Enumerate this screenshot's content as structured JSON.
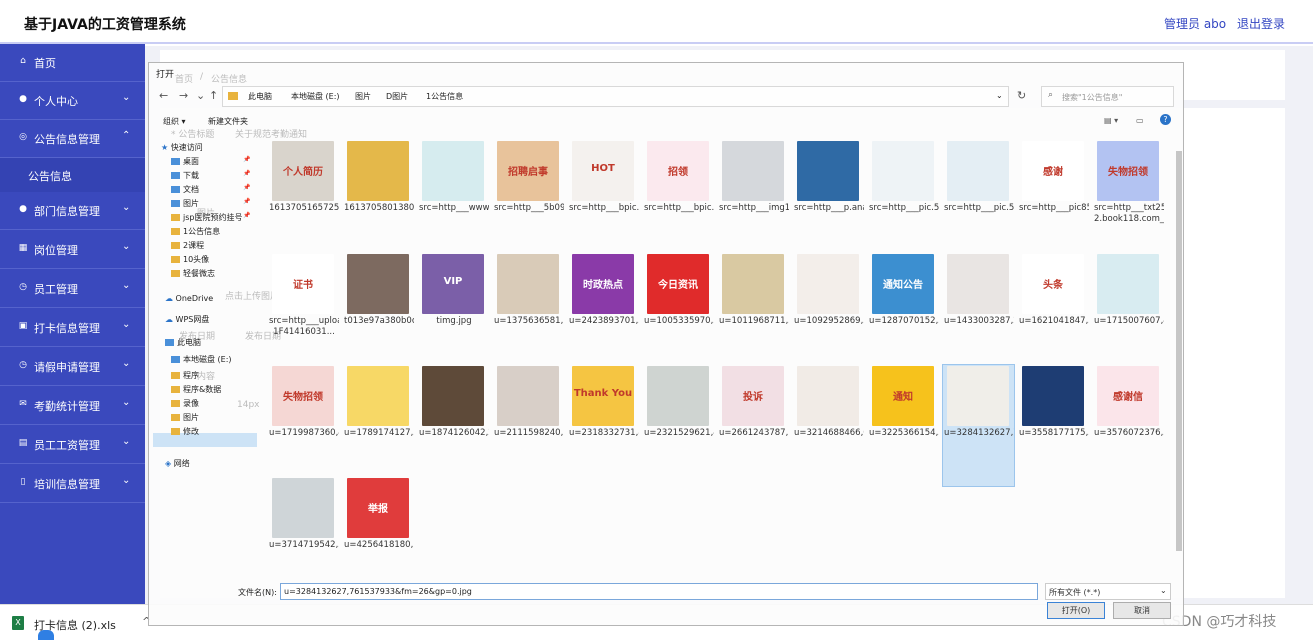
{
  "app": {
    "title": "基于JAVA的工资管理系统",
    "user": "管理员 abo",
    "logout": "退出登录"
  },
  "sidebar": {
    "items": [
      {
        "label": "首页",
        "icon": "home-icon"
      },
      {
        "label": "个人中心",
        "icon": "user-icon"
      },
      {
        "label": "公告信息管理",
        "icon": "info-icon"
      },
      {
        "label": "部门信息管理",
        "icon": "user-icon"
      },
      {
        "label": "岗位管理",
        "icon": "grid-icon"
      },
      {
        "label": "员工管理",
        "icon": "clock-icon"
      },
      {
        "label": "打卡信息管理",
        "icon": "clock-in-icon"
      },
      {
        "label": "请假申请管理",
        "icon": "clock-icon"
      },
      {
        "label": "考勤统计管理",
        "icon": "stats-icon"
      },
      {
        "label": "员工工资管理",
        "icon": "salary-icon"
      },
      {
        "label": "培训信息管理",
        "icon": "training-icon"
      }
    ],
    "sub_item": "公告信息"
  },
  "ghost": {
    "breadcrumb_home": "首页",
    "breadcrumb_sep": "/",
    "breadcrumb_current": "公告信息",
    "title_label": "* 公告标题",
    "title_value": "关于规范考勤通知",
    "image_label": "图片",
    "upload_hint": "点击上传图片",
    "publish_date": "发布日期",
    "publish_date_value": "发布日期",
    "content_label": "内容",
    "editor_font_size": "14px",
    "editor_body": "文本"
  },
  "dialog": {
    "title": "打开",
    "path": [
      "此电脑",
      "本地磁盘 (E:)",
      "图片",
      "D图片",
      "1公告信息"
    ],
    "search_placeholder": "搜索\"1公告信息\"",
    "organize": "组织 ▾",
    "new_folder": "新建文件夹",
    "tree": [
      {
        "label": "快速访问",
        "type": "star"
      },
      {
        "label": "桌面",
        "type": "blue",
        "pin": true
      },
      {
        "label": "下载",
        "type": "blue",
        "pin": true
      },
      {
        "label": "文档",
        "type": "blue",
        "pin": true
      },
      {
        "label": "图片",
        "type": "blue",
        "pin": true
      },
      {
        "label": "jsp医院预约挂号",
        "type": "folder",
        "pin": true
      },
      {
        "label": "1公告信息",
        "type": "folder"
      },
      {
        "label": "2课程",
        "type": "folder"
      },
      {
        "label": "10头像",
        "type": "folder"
      },
      {
        "label": "轻餐微志",
        "type": "folder"
      },
      {
        "label": "OneDrive",
        "type": "cloud"
      },
      {
        "label": "WPS网盘",
        "type": "cloud"
      },
      {
        "label": "此电脑",
        "type": "pc"
      },
      {
        "label": "本地磁盘 (E:)",
        "type": "disk"
      },
      {
        "label": "程序",
        "type": "folder"
      },
      {
        "label": "程序&数据",
        "type": "folder"
      },
      {
        "label": "录像",
        "type": "folder"
      },
      {
        "label": "图片",
        "type": "folder"
      },
      {
        "label": "修改",
        "type": "folder"
      },
      {
        "label": "网络",
        "type": "net"
      }
    ],
    "files": [
      {
        "name": "1613705165725.jpg",
        "color": "#d9d4cc",
        "cap": "个人简历"
      },
      {
        "name": "1613705801380.jpeg",
        "color": "#e4b84a",
        "cap": ""
      },
      {
        "name": "src=http___www.bdcrbyy.cn_keditor_attached_image_20...",
        "color": "#d6ecef",
        "cap": ""
      },
      {
        "name": "src=http___5b0988e595225.cdn.sohucs.com_images_20180...",
        "color": "#e8c39b",
        "cap": "招聘启事"
      },
      {
        "name": "src=http___bpic.588ku.com_element_origin_min_pic_16_11_3...",
        "color": "#f4f1ee",
        "cap": "HOT"
      },
      {
        "name": "src=http___bpic.588ku.com_element_origin_min_pic_19_05_1...",
        "color": "#fbe9ee",
        "cap": "招领"
      },
      {
        "name": "src=http___img11.360buyimg.com_n1_jfs_t1_26983_14_14517...",
        "color": "#d5d8dc",
        "cap": ""
      },
      {
        "name": "src=http___p.ananas.chaoxing.com_star3_origin_705d524ffd9...",
        "color": "#2f6aa5",
        "cap": ""
      },
      {
        "name": "src=http___pic.51yuansu.com_pic3_cover_00_78_76_58c7152a...",
        "color": "#eef3f6",
        "cap": ""
      },
      {
        "name": "src=http___pic.51yuansu.com_pic3_cover_03_43_68_5b9f8c09...",
        "color": "#e4eef4",
        "cap": ""
      },
      {
        "name": "src=http___pic85.nipic.com_file_20151220_3575365_14492347...",
        "color": "#ffffff",
        "cap": "感谢"
      },
      {
        "name": "src=http___txt25-2.book118.com_2017_0620_book116830_1...",
        "color": "#b3c3f2",
        "cap": "失物招领"
      },
      {
        "name": "src=http___uploads.xuexila.com_allimg_1704_676-1F41416031...",
        "color": "#ffffff",
        "cap": "证书"
      },
      {
        "name": "t013e97a380b0c7b888.png",
        "color": "#7d6a60",
        "cap": ""
      },
      {
        "name": "timg.jpg",
        "color": "#7b5fa8",
        "cap": "VIP"
      },
      {
        "name": "u=1375636581,1625421078&fm=15&gp=0.jpg",
        "color": "#d9cbb8",
        "cap": ""
      },
      {
        "name": "u=2423893701,3428732597&fm=26&gp=0.jpg",
        "color": "#8a3aa8",
        "cap": "时政热点"
      },
      {
        "name": "u=1005335970,3723003773&fm=26&gp=0.jpg",
        "color": "#e02b2b",
        "cap": "今日资讯"
      },
      {
        "name": "u=1011968711,3889446553&fm=26&gp=0.jpg",
        "color": "#d9c9a2",
        "cap": ""
      },
      {
        "name": "u=1092952869,3467665900&fm=26&gp=0.jpg",
        "color": "#f3eeea",
        "cap": ""
      },
      {
        "name": "u=1287070152,3180436270&fm=26&gp=0.jpg",
        "color": "#3c8fd0",
        "cap": "通知公告"
      },
      {
        "name": "u=1433003287,2307919880&fm=26&gp=0.jpg",
        "color": "#e9e5e3",
        "cap": ""
      },
      {
        "name": "u=1621041847,3352666580&fm=26&gp=0.jpg",
        "color": "#ffffff",
        "cap": "头条"
      },
      {
        "name": "u=1715007607,4135670608&fm=26&gp=0.jpg",
        "color": "#d8ecf1",
        "cap": ""
      },
      {
        "name": "u=1719987360,4269855352&fm=26&gp=0.jpg",
        "color": "#f5d7d4",
        "cap": "失物招领"
      },
      {
        "name": "u=1789174127,3895645957&fm=26&gp=0.jpg",
        "color": "#f7d866",
        "cap": ""
      },
      {
        "name": "u=1874126042,2925198873&fm=26&gp=0.jpg",
        "color": "#5e4a39",
        "cap": ""
      },
      {
        "name": "u=2111598240,1751901435&fm=15&gp=0.jpg",
        "color": "#d8cfc8",
        "cap": ""
      },
      {
        "name": "u=2318332731,8811569696&fm=26&gp=0.jpg",
        "color": "#f5c542",
        "cap": "Thank You"
      },
      {
        "name": "u=2321529621,4274583971&fm=26&gp=0.jpg",
        "color": "#cfd4d1",
        "cap": ""
      },
      {
        "name": "u=2661243787,1626505511&fm=26&gp=0.jpg",
        "color": "#f2dfe4",
        "cap": "投诉"
      },
      {
        "name": "u=3214688466,6505952542&fm=26&gp=0.jpg",
        "color": "#f1ebe6",
        "cap": ""
      },
      {
        "name": "u=3225366154,3087999066&fm=26&gp=0.jpg",
        "color": "#f6c21c",
        "cap": "通知"
      },
      {
        "name": "u=3284132627,7615379338&fm=26&gp=0.jpg",
        "color": "#f0eee9",
        "cap": "",
        "selected": true
      },
      {
        "name": "u=3558177175,3695096266&fm=26&gp=0.jpg",
        "color": "#1e3d73",
        "cap": ""
      },
      {
        "name": "u=3576072376,3186374508&fm=26&gp=0.jpg",
        "color": "#fbe5ea",
        "cap": "感谢信"
      },
      {
        "name": "u=3714719542,3694019852&fm=26&gp=0.jpg",
        "color": "#cfd5d8",
        "cap": ""
      },
      {
        "name": "u=4256418180,1844492340&fm=26&gp=0.jpg",
        "color": "#e03c3c",
        "cap": "举报"
      }
    ],
    "filename_label": "文件名(N):",
    "filename_value": "u=3284132627,761537933&fm=26&gp=0.jpg",
    "filetype": "所有文件 (*.*)",
    "open_button": "打开(O)",
    "cancel_button": "取消"
  },
  "taskbar": {
    "file": "打卡信息 (2).xls",
    "arrow": "^"
  },
  "watermark": "CSDN @巧才科技"
}
